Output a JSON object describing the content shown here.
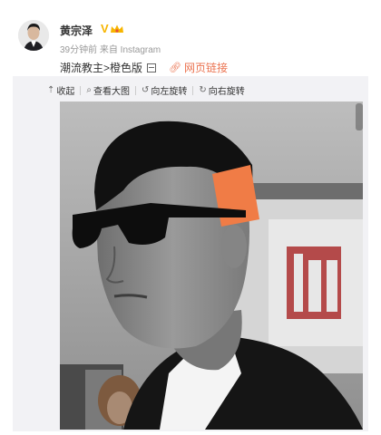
{
  "header": {
    "user_name": "黄宗泽",
    "verified_mark": "V",
    "meta": "39分钟前 来自 Instagram"
  },
  "post": {
    "text": "潮流教主>橙色版",
    "link_label": "网页链接"
  },
  "toolbar": {
    "collapse": "收起",
    "view_large": "查看大图",
    "rotate_left": "向左旋转",
    "rotate_right": "向右旋转"
  },
  "colors": {
    "link": "#eb7350",
    "verified": "#f7b500",
    "panel_bg": "#f2f2f5"
  }
}
